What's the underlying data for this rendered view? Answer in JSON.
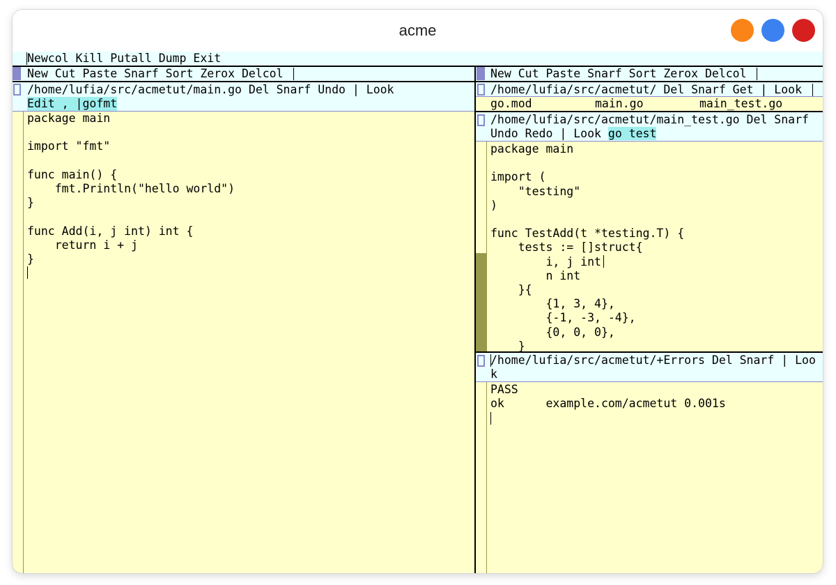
{
  "window": {
    "title": "acme",
    "buttons": [
      {
        "name": "minimize",
        "color": "#fa8418"
      },
      {
        "name": "maximize",
        "color": "#3b82f0"
      },
      {
        "name": "close",
        "color": "#d61f1f"
      }
    ]
  },
  "colors": {
    "tag_background": "#eaffff",
    "body_background": "#ffffcc",
    "highlight": "#9eeeee",
    "border": "#8888cc",
    "scroll_thumb": "#99994c"
  },
  "main_tag": {
    "commands": "Newcol Kill Putall Dump Exit"
  },
  "columns": [
    {
      "tag": "New Cut Paste Snarf Sort Zerox Delcol",
      "windows": [
        {
          "tag_line1": "/home/lufia/src/acmetut/main.go Del Snarf Undo | Look",
          "tag_line2": "Edit , |gofmt",
          "body": "package main\n\nimport \"fmt\"\n\nfunc main() {\n    fmt.Println(\"hello world\")\n}\n\nfunc Add(i, j int) int {\n    return i + j\n}"
        }
      ]
    },
    {
      "tag": "New Cut Paste Snarf Sort Zerox Delcol",
      "windows": [
        {
          "tag": "/home/lufia/src/acmetut/ Del Snarf Get | Look",
          "files": [
            "go.mod",
            "main.go",
            "main_test.go"
          ]
        },
        {
          "tag_line1": "/home/lufia/src/acmetut/main_test.go Del Snarf",
          "tag_line2_plain": "Undo Redo | Look ",
          "tag_line2_highlight": "go test",
          "body": "package main\n\nimport (\n    \"testing\"\n)\n\nfunc TestAdd(t *testing.T) {\n    tests := []struct{\n        i, j int\n        n int\n    }{\n        {1, 3, 4},\n        {-1, -3, -4},\n        {0, 0, 0},\n    }"
        },
        {
          "tag_line1": "/home/lufia/src/acmetut/+Errors Del Snarf | Loo",
          "tag_line2": "k",
          "body": "PASS\nok      example.com/acmetut 0.001s"
        }
      ]
    }
  ]
}
